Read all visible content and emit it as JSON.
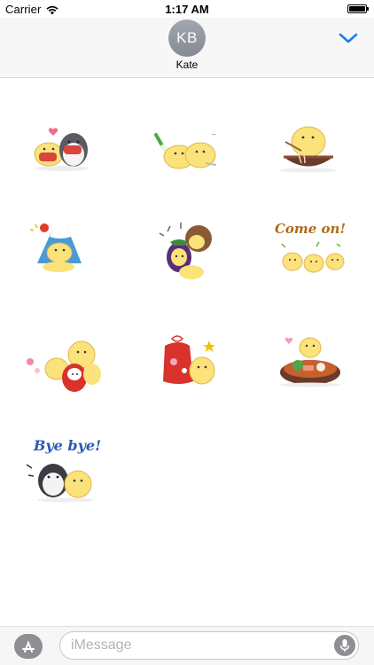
{
  "status_bar": {
    "carrier": "Carrier",
    "time": "1:17 AM",
    "battery_level": 1.0,
    "icons": [
      "wifi-icon",
      "battery-icon"
    ]
  },
  "header": {
    "avatar_initials": "KB",
    "contact_name": "Kate",
    "avatar_color": "#8d9199",
    "chevron_icon": "chevron-down-icon",
    "accent_color": "#1a7ff2"
  },
  "stickers": {
    "items": [
      {
        "name": "chick-and-penguin-eating"
      },
      {
        "name": "chicks-with-leek"
      },
      {
        "name": "chick-eating-noodles"
      },
      {
        "name": "chick-mount-fuji"
      },
      {
        "name": "chick-eggplant-hawk"
      },
      {
        "name": "chicks-come-on",
        "text": "Come on!"
      },
      {
        "name": "chicks-daruma"
      },
      {
        "name": "chick-lucky-bag"
      },
      {
        "name": "chick-sukiyaki"
      },
      {
        "name": "penguin-chick-bye-bye",
        "text": "Bye bye!"
      }
    ]
  },
  "input_bar": {
    "placeholder": "iMessage",
    "app_button_icon": "app-store-icon",
    "mic_icon": "microphone-icon"
  }
}
